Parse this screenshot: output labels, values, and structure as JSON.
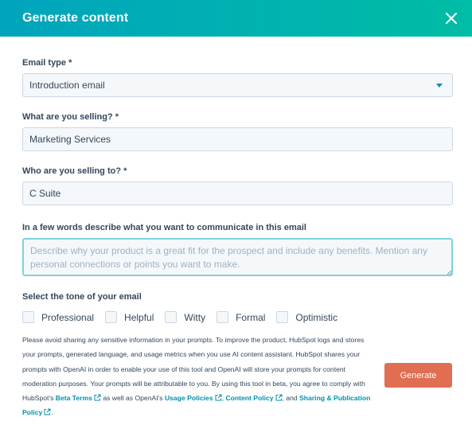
{
  "dialog": {
    "title": "Generate content",
    "close_icon": "close-icon"
  },
  "form": {
    "email_type": {
      "label": "Email type *",
      "value": "Introduction email"
    },
    "selling": {
      "label": "What are you selling? *",
      "value": "Marketing Services"
    },
    "selling_to": {
      "label": "Who are you selling to? *",
      "value": "C Suite"
    },
    "communicate": {
      "label": "In a few words describe what you want to communicate in this email",
      "placeholder": "Describe why your product is a great fit for the prospect and include any benefits. Mention any personal connections or points you want to make."
    },
    "tone": {
      "label": "Select the tone of your email",
      "options": [
        "Professional",
        "Helpful",
        "Witty",
        "Formal",
        "Optimistic"
      ]
    }
  },
  "disclaimer": {
    "text": "Please avoid sharing any sensitive information in your prompts. To improve the product, HubSpot logs and stores your prompts, generated language, and usage metrics when you use AI content assistant. HubSpot shares your prompts with OpenAI in order to enable your use of this tool and OpenAI will store your prompts for content moderation purposes. Your prompts will be attributable to you. By using this tool in beta, you agree to comply with HubSpot's",
    "beta_terms": "Beta Terms",
    "mid": "as well as OpenAI's",
    "usage_policies": "Usage Policies",
    "comma": ",",
    "content_policy": "Content Policy",
    "and": ", and",
    "sharing_policy": "Sharing & Publication Policy",
    "end": "."
  },
  "actions": {
    "generate_label": "Generate"
  },
  "colors": {
    "header_start": "#00a4bd",
    "header_end": "#00bda5",
    "generate": "#e06e51",
    "link": "#0091ae"
  }
}
